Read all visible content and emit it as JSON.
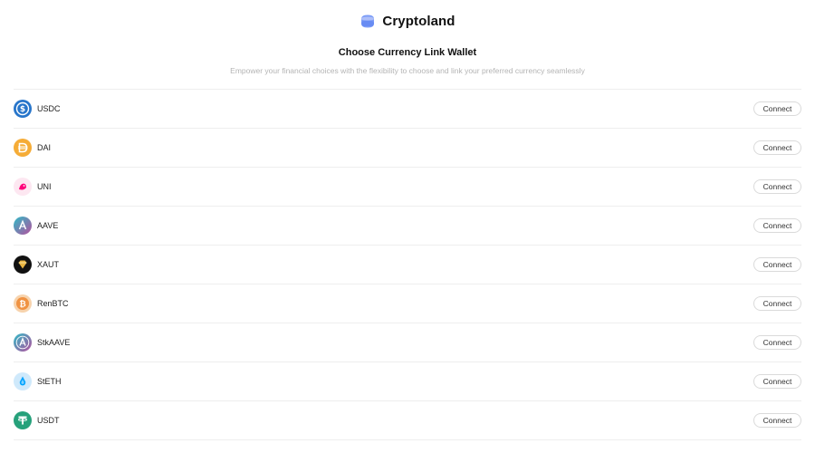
{
  "brand": {
    "name": "Cryptoland",
    "logo_icon": "wallet-icon",
    "logo_color": "#6b8cf5"
  },
  "page": {
    "title": "Choose Currency Link Wallet",
    "subtitle": "Empower your financial choices with the flexibility to choose and link your preferred currency seamlessly"
  },
  "currencies": [
    {
      "symbol": "USDC",
      "icon": "usdc-icon",
      "color": "#2775ca",
      "action": "Connect"
    },
    {
      "symbol": "DAI",
      "icon": "dai-icon",
      "color": "#f5ac37",
      "action": "Connect"
    },
    {
      "symbol": "UNI",
      "icon": "uni-icon",
      "color": "#ff007a",
      "action": "Connect"
    },
    {
      "symbol": "AAVE",
      "icon": "aave-icon",
      "color": "#b6509e",
      "action": "Connect"
    },
    {
      "symbol": "XAUT",
      "icon": "xaut-icon",
      "color": "#111111",
      "action": "Connect"
    },
    {
      "symbol": "RenBTC",
      "icon": "renbtc-icon",
      "color": "#f09242",
      "action": "Connect"
    },
    {
      "symbol": "StkAAVE",
      "icon": "stkaave-icon",
      "color": "#b6509e",
      "action": "Connect"
    },
    {
      "symbol": "StETH",
      "icon": "steth-icon",
      "color": "#00a3ff",
      "action": "Connect"
    },
    {
      "symbol": "USDT",
      "icon": "usdt-icon",
      "color": "#26a17b",
      "action": "Connect"
    }
  ]
}
